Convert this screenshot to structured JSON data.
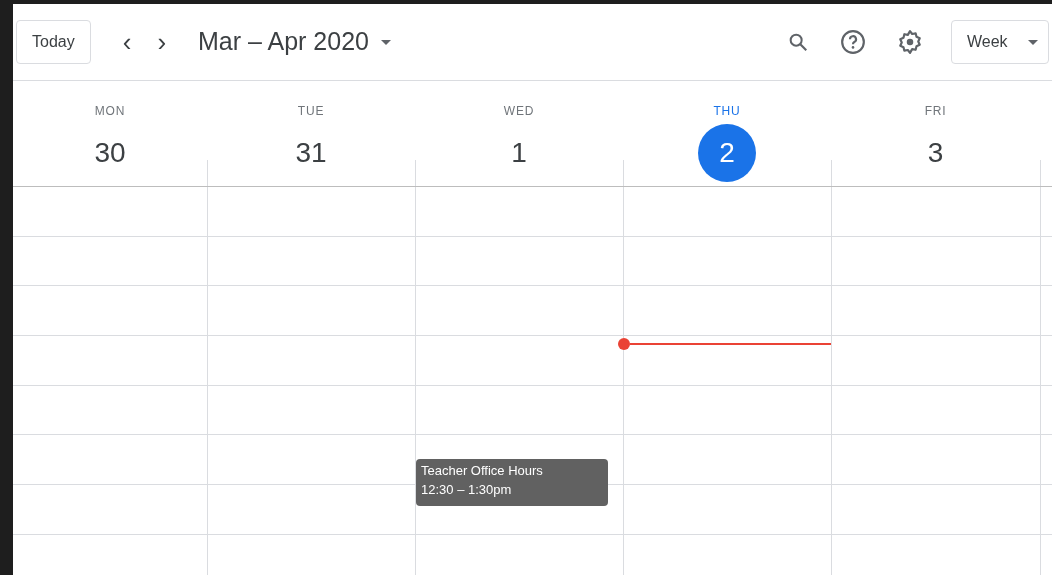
{
  "toolbar": {
    "today_button": "Today",
    "prev": "‹",
    "next": "›",
    "date_range": "Mar – Apr 2020",
    "view_button": "Week"
  },
  "days": [
    {
      "name": "MON",
      "number": "30",
      "selected": false
    },
    {
      "name": "TUE",
      "number": "31",
      "selected": false
    },
    {
      "name": "WED",
      "number": "1",
      "selected": false,
      "events": [
        {
          "title": "Teacher Office Hours",
          "time": "12:30 – 1:30pm"
        }
      ]
    },
    {
      "name": "THU",
      "number": "2",
      "selected": true
    },
    {
      "name": "FRI",
      "number": "3",
      "selected": false
    }
  ]
}
